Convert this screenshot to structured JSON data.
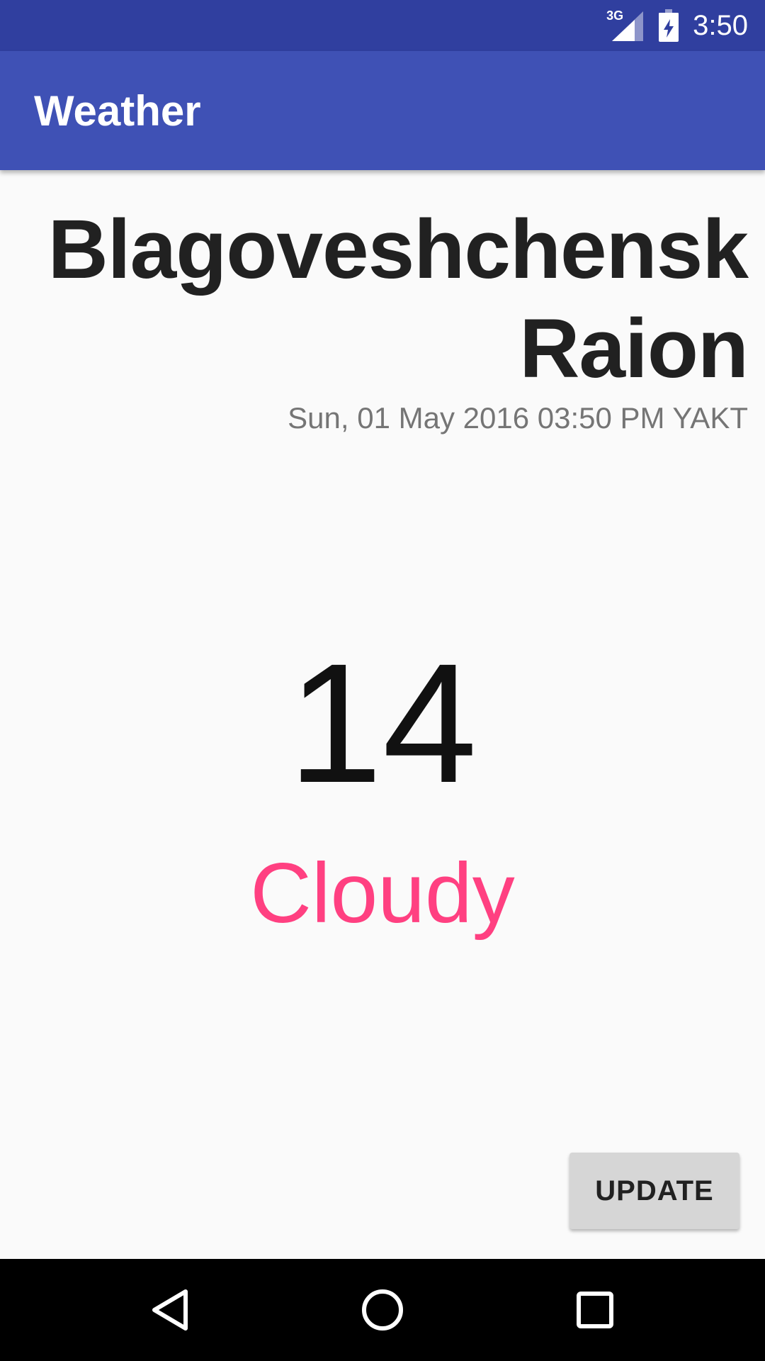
{
  "status_bar": {
    "network_label": "3G",
    "time": "3:50",
    "icons": [
      "signal-icon",
      "battery-charging-icon"
    ]
  },
  "app_bar": {
    "title": "Weather"
  },
  "weather": {
    "city": "Blagoveshchensk Raion",
    "datetime": "Sun, 01 May 2016 03:50 PM YAKT",
    "temperature": "14",
    "condition": "Cloudy"
  },
  "actions": {
    "update_label": "UPDATE"
  },
  "nav_bar": {
    "icons": [
      "back-icon",
      "home-icon",
      "recents-icon"
    ]
  },
  "colors": {
    "status_bar": "#303f9f",
    "app_bar": "#3f51b5",
    "accent": "#ff4081",
    "background": "#fafafa"
  }
}
